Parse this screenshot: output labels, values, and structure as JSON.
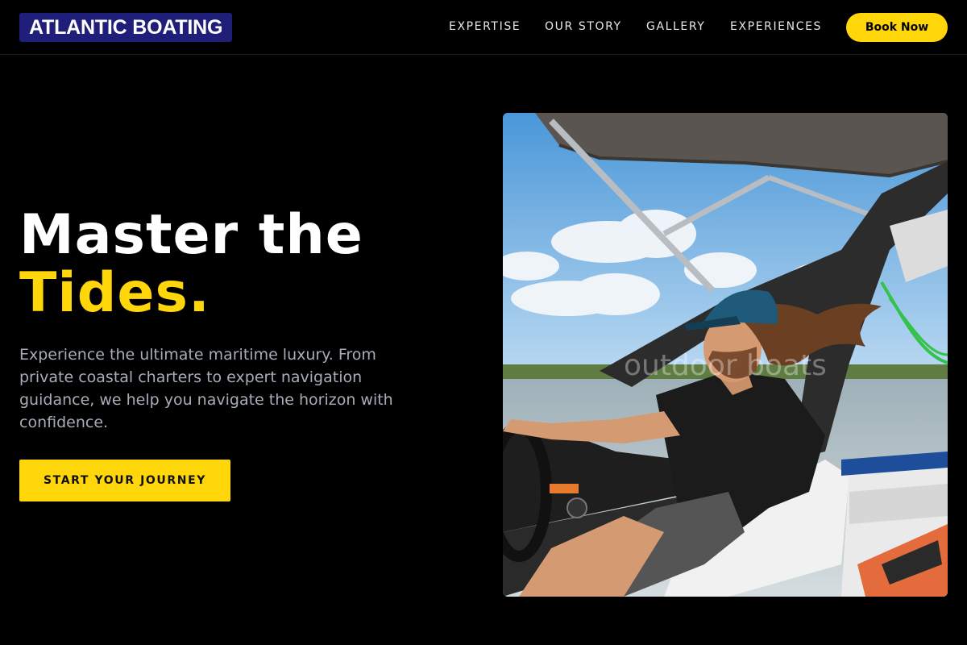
{
  "header": {
    "logo": "ATLANTIC BOATING",
    "nav": [
      "EXPERTISE",
      "OUR STORY",
      "GALLERY",
      "EXPERIENCES"
    ],
    "book_label": "Book Now"
  },
  "hero": {
    "headline_line1": "Master the",
    "headline_accent": "Tides.",
    "lead": "Experience the ultimate maritime luxury. From private coastal charters to expert navigation guidance, we help you navigate the horizon with confidence.",
    "cta_label": "START YOUR JOURNEY",
    "image_alt": "Man with long hair driving a boat under a wakeboard tower"
  },
  "colors": {
    "background": "#000000",
    "accent": "#ffd60a",
    "logo_bg": "#1f1f7a",
    "lead_text": "#a7adb7"
  }
}
